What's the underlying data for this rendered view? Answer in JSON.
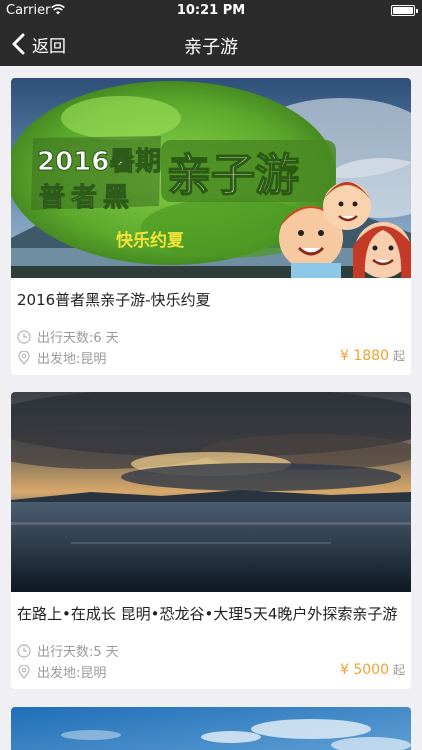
{
  "status_bar": {
    "carrier": "Carrier",
    "time": "10:21 PM"
  },
  "nav": {
    "back_label": "返回",
    "title": "亲子游"
  },
  "cards": [
    {
      "banner_title": "2016暑期",
      "banner_sub": "普者黑",
      "banner_big": "亲子游",
      "banner_tag": "快乐约夏",
      "title": "2016普者黑亲子游-快乐约夏",
      "days": "出行天数:6 天",
      "departure": "出发地:昆明",
      "price": "¥ 1880",
      "price_unit": "起"
    },
    {
      "title": "在路上•在成长 昆明•恐龙谷•大理5天4晚户外探索亲子游",
      "days": "出行天数:5 天",
      "departure": "出发地:昆明",
      "price": "¥ 5000",
      "price_unit": "起"
    }
  ],
  "icons": {
    "back": "chevron-left-icon",
    "days": "clock-icon",
    "departure": "location-pin-icon"
  },
  "colors": {
    "nav_bg": "#2b2b2b",
    "price": "#f0a22e",
    "page_bg": "#efeff4"
  }
}
